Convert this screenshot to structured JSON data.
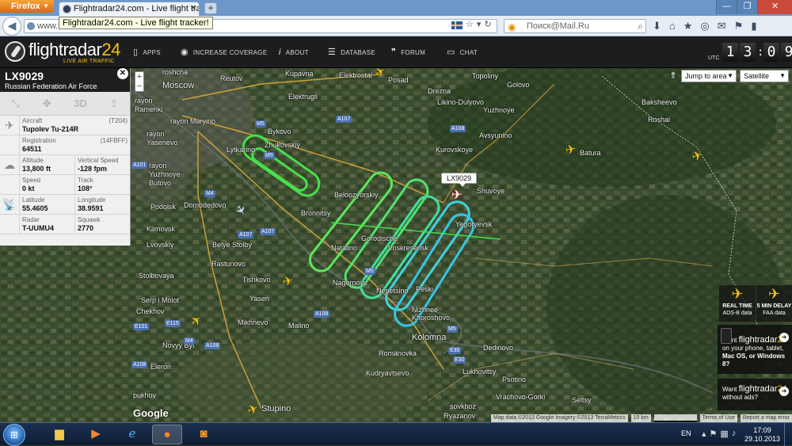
{
  "browser": {
    "menu_button": "Firefox",
    "tab_title": "Flightradar24.com - Live flight tracker!",
    "tooltip": "Flightradar24.com - Live flight tracker!",
    "url": "www.fli",
    "search_placeholder": "Поиск@Mail.Ru"
  },
  "header": {
    "brand_main": "flightradar",
    "brand_num": "24",
    "tagline": "LIVE AIR TRAFFIC",
    "nav": [
      "APPS",
      "INCREASE COVERAGE",
      "ABOUT",
      "DATABASE",
      "FORUM",
      "CHAT"
    ],
    "utc_label": "UTC",
    "clock": [
      "1",
      "3",
      "0",
      "9"
    ]
  },
  "map_controls": {
    "zoom_in": "+",
    "zoom_out": "−",
    "jump_to_area": "Jump to area",
    "map_type": "Satellite"
  },
  "flight": {
    "callsign": "LX9029",
    "operator": "Russian Federation Air Force",
    "tool_3d": "3D",
    "aircraft_label": "Aircraft",
    "aircraft_code": "(T204)",
    "aircraft": "Tupolev Tu-214R",
    "registration_label": "Registration",
    "registration_code": "(14FBFF)",
    "registration": "64511",
    "altitude_label": "Altitude",
    "altitude": "13,800 ft",
    "vspeed_label": "Vertical Speed",
    "vspeed": "-128 fpm",
    "speed_label": "Speed",
    "speed": "0 kt",
    "track_label": "Track",
    "track": "108°",
    "latitude_label": "Latitude",
    "latitude": "55.4605",
    "longitude_label": "Longitude",
    "longitude": "38.9591",
    "radar_label": "Radar",
    "radar": "T-UUMU4",
    "squawk_label": "Squawk",
    "squawk": "2770"
  },
  "map_labels": {
    "moscow": "Moscow",
    "roshcha": "roshcha",
    "reutov": "Reutov",
    "kupavna": "Kupavna",
    "elektrostal": "Elektrostal",
    "posad": "Posad",
    "topoliny": "Topoliny",
    "elektrugli": "Elektrugli",
    "ramenki": "rayon Ramenki",
    "maryino": "rayon Maryino",
    "yasenevo": "rayon Yasenevo",
    "bykovo": "Bykovo",
    "zhukovskiy": "Zhukovskiy",
    "lytkarino": "Lytkarino",
    "drezna": "Drezna",
    "likino": "Likino-Dulyovo",
    "golovo": "Golovo",
    "baksheevo": "Baksheevo",
    "roshal": "Roshal",
    "yuzhnoye": "Yuzhnoye",
    "kurovskoye": "Kurovskoye",
    "avsyunino": "Avsyunino",
    "batura": "Batura",
    "butovo": "rayon Yuzhnoye Butovo",
    "podolsk": "Podolsk",
    "domodedovo": "Domodedovo",
    "beloozerskiy": "Beloozyorskiy",
    "bronnitsy": "Bronnitsy",
    "shuvoye": "Shuvoye",
    "yegoryevsk": "Yegoryevsk",
    "klimovsk": "Klimovsk",
    "lvovskiy": "Lvovskiy",
    "stolby": "Belye Stolby",
    "rastunovo": "Rastunovo",
    "natalino": "Natalino",
    "voskresensk": "Voskresensk",
    "gorodische": "Gorodische",
    "stolbovaya": "Stolbovaya",
    "tishkovo": "Tishkovo",
    "nagornoye": "Nagornoye",
    "nepetsino": "Nepetsino",
    "peski": "Peski",
    "molot": "Serp i Molot",
    "chekhov": "Chekhov",
    "yasen": "Yasen",
    "mikhnevo": "Mikhnevo",
    "malino": "Malino",
    "nizhnee": "Nizhnee Khoroshovo",
    "kolomna": "Kolomna",
    "dedinovo": "Dedinovo",
    "novyy_byt": "Novyy Byt",
    "eleron": "Eleron",
    "romanovka": "Romanovka",
    "lukhovitsy": "Lukhovitsy",
    "psotino": "Psotino",
    "kudryavtsevo": "Kudryavtsevo",
    "vrachovo": "Vrachovo-Gorki",
    "seltsy": "Seltsy",
    "stupino": "Stupino",
    "pukhov": "pukhov",
    "sovkhoz": "sovkhoz",
    "ryazanov": "Ryazanov"
  },
  "roads": [
    "M5",
    "M5",
    "M5",
    "M5",
    "M4",
    "M4",
    "A107",
    "A107",
    "A107",
    "A108",
    "A108",
    "A108",
    "A108",
    "A101",
    "E30",
    "E30",
    "E101",
    "E115"
  ],
  "promo": {
    "realtime_title": "REAL TIME",
    "realtime_sub": "ADS-B data",
    "delay_title": "5 MIN DELAY",
    "delay_sub": "FAA data",
    "apps_want": "Want",
    "apps_brand": "flightradar",
    "apps_num": "24",
    "apps_line1": "on your phone, tablet,",
    "apps_line2": "Mac OS, or Windows 8?",
    "ads_want": "Want",
    "ads_brand": "flightradar",
    "ads_num": "24",
    "ads_line": "without ads?"
  },
  "footer": {
    "google": "Google",
    "map_data": "Map data ©2013 Google Imagery ©2013 TerraMetrics",
    "scale": "10 km",
    "terms": "Terms of Use",
    "report": "Report a map error"
  },
  "taskbar": {
    "lang": "EN",
    "time": "17:09",
    "date": "29.10.2013"
  },
  "colors": {
    "accent": "#f2c010",
    "track_green": "#46e04a",
    "track_cyan": "#3fd1e0"
  }
}
